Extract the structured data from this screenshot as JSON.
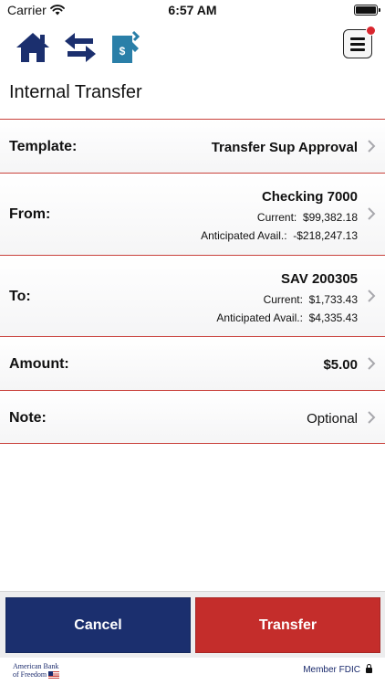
{
  "status_bar": {
    "carrier": "Carrier",
    "time": "6:57 AM"
  },
  "toolbar": {
    "icons": [
      "home-icon",
      "transfer-arrows-icon",
      "mobile-deposit-icon"
    ],
    "menu_icon": "hamburger-menu-icon",
    "notification_color": "#d9262e"
  },
  "page": {
    "title": "Internal Transfer"
  },
  "form": {
    "template": {
      "label": "Template:",
      "value": "Transfer Sup Approval"
    },
    "from": {
      "label": "From:",
      "account": "Checking 7000",
      "current_label": "Current:",
      "current_value": "$99,382.18",
      "anticipated_label": "Anticipated Avail.:",
      "anticipated_value": "-$218,247.13"
    },
    "to": {
      "label": "To:",
      "account": "SAV 200305",
      "current_label": "Current:",
      "current_value": "$1,733.43",
      "anticipated_label": "Anticipated Avail.:",
      "anticipated_value": "$4,335.43"
    },
    "amount": {
      "label": "Amount:",
      "value": "$5.00"
    },
    "note": {
      "label": "Note:",
      "value": "Optional"
    }
  },
  "buttons": {
    "cancel_label": "Cancel",
    "transfer_label": "Transfer"
  },
  "footer": {
    "logo_line1": "American Bank",
    "logo_line2": "of Freedom",
    "fdic": "Member FDIC"
  },
  "colors": {
    "brand_navy": "#1b2f6e",
    "accent_red": "#c42d2b",
    "icon_teal": "#2a7fa8",
    "divider_red": "#c9423c"
  }
}
